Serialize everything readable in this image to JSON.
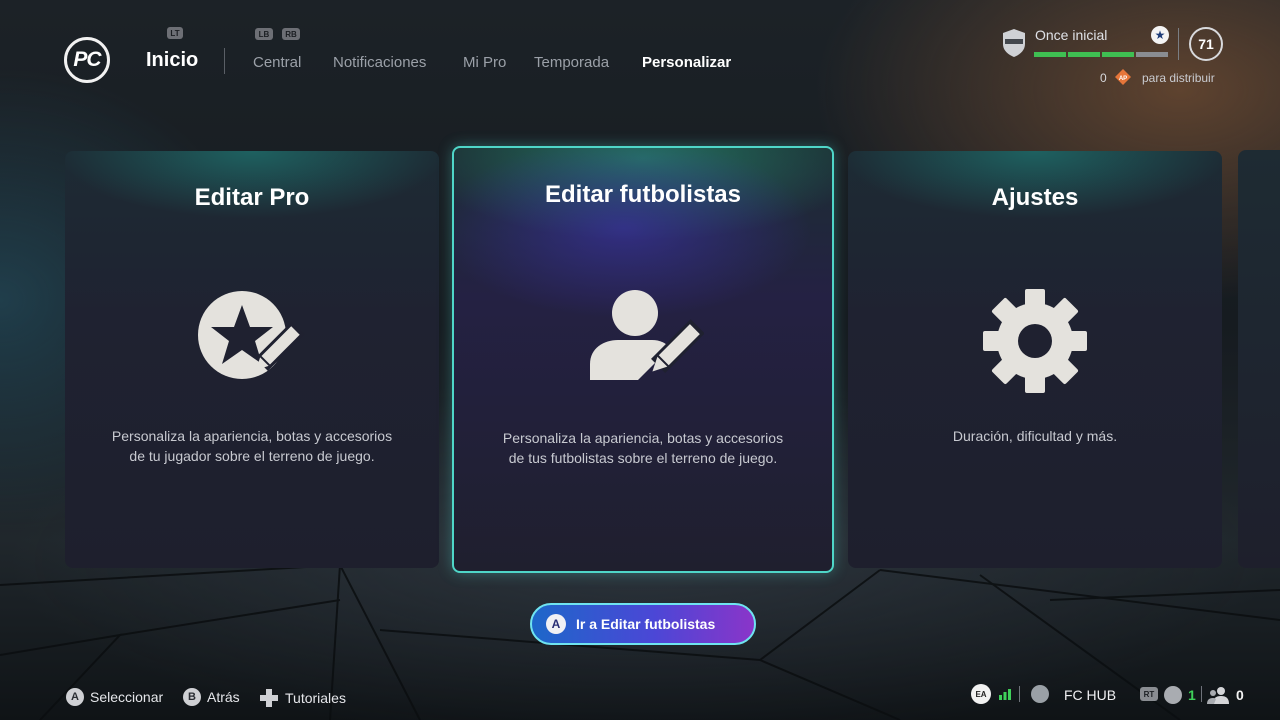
{
  "header": {
    "logo_text": "PC",
    "lt_hint": "LT",
    "lb_hint": "LB",
    "rb_hint": "RB",
    "home_label": "Inicio",
    "tabs": [
      {
        "label": "Central",
        "active": false
      },
      {
        "label": "Notificaciones",
        "active": false
      },
      {
        "label": "Mi Pro",
        "active": false
      },
      {
        "label": "Temporada",
        "active": false
      },
      {
        "label": "Personalizar",
        "active": true
      }
    ]
  },
  "status": {
    "squad_label": "Once inicial",
    "squad_progress_segments": [
      true,
      true,
      true,
      false
    ],
    "overall_rating": "71",
    "ap_points": "0",
    "ap_icon_text": "AP",
    "ap_label": "para distribuir"
  },
  "cards": [
    {
      "title": "Editar Pro",
      "icon": "star-pencil-icon",
      "description": "Personaliza la apariencia, botas y accesorios de tu jugador sobre el terreno de juego.",
      "selected": false
    },
    {
      "title": "Editar futbolistas",
      "icon": "person-pencil-icon",
      "description": "Personaliza la apariencia, botas y accesorios de tus futbolistas sobre el terreno de juego.",
      "selected": true
    },
    {
      "title": "Ajustes",
      "icon": "gear-icon",
      "description": "Duración, dificultad y más.",
      "selected": false
    }
  ],
  "cta": {
    "button_glyph": "A",
    "label": "Ir a Editar futbolistas"
  },
  "footer": {
    "select": {
      "glyph": "A",
      "label": "Seleccionar"
    },
    "back": {
      "glyph": "B",
      "label": "Atrás"
    },
    "tutorials": {
      "label": "Tutoriales"
    },
    "ea_text": "EA",
    "hub_label": "FC HUB",
    "rt_hint": "RT",
    "voice_count": "1",
    "party_count": "0"
  },
  "colors": {
    "accent_teal": "#4fd6c8",
    "cta_gradient_start": "#1d67c9",
    "cta_gradient_end": "#8a35c9",
    "progress_green": "#3fbf52"
  }
}
